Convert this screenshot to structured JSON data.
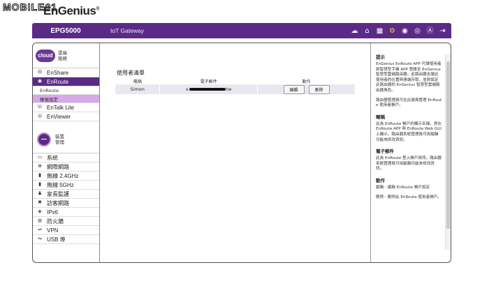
{
  "watermark": {
    "site_text": "MOBILE01",
    "logo_text": "EnGenius",
    "registered_mark": "®"
  },
  "header": {
    "model": "EPG5000",
    "section": "IoT Gateway"
  },
  "header_icons": [
    "cloud-upload-icon",
    "home-icon",
    "building-icon",
    "gear-icon",
    "wireless-icon",
    "webcam-icon",
    "language-icon",
    "logout-icon"
  ],
  "cloud": {
    "badge": "cloud",
    "title": "雲端服務"
  },
  "cloud_nav": [
    {
      "label": "EnShare",
      "icon": "share-icon"
    },
    {
      "label": "EnRoute",
      "icon": "pin-icon",
      "active": true
    }
  ],
  "enroute_sub": [
    {
      "label": "EnRoute"
    },
    {
      "label": "帳號設定",
      "active": true
    }
  ],
  "cloud_nav2": [
    {
      "label": "EnTalk Lite",
      "icon": "phone-icon"
    },
    {
      "label": "EnViewer",
      "icon": "eye-icon"
    }
  ],
  "mgmt": {
    "title": "裝置管理"
  },
  "mgmt_nav": [
    {
      "label": "系統",
      "icon": "monitor-icon"
    },
    {
      "label": "網際網路",
      "icon": "globe-icon"
    },
    {
      "label": "無線 2.4GHz",
      "icon": "signal-icon"
    },
    {
      "label": "無線 5GHz",
      "icon": "signal-icon"
    },
    {
      "label": "家長監護",
      "icon": "family-icon"
    },
    {
      "label": "訪客網路",
      "icon": "tools-icon"
    },
    {
      "label": "IPv6",
      "icon": "ipv6-icon"
    },
    {
      "label": "防火牆",
      "icon": "firewall-icon"
    },
    {
      "label": "VPN",
      "icon": "vpn-icon"
    },
    {
      "label": "USB 埠",
      "icon": "usb-icon"
    }
  ],
  "main": {
    "title": "使用者清單",
    "columns": {
      "name": "暱稱",
      "email": "電子郵件",
      "action": "動作"
    },
    "rows": [
      {
        "name": "Simon",
        "email_start": "s",
        "email_end": "tw",
        "edit": "編輯",
        "delete": "刪除"
      }
    ]
  },
  "help": {
    "title": "提示",
    "intro": "EnGenius EnRoute APP 可讓使用者將智慧型手機 APP 登錄至 EnGenius 智慧型雲端路由器。此路由器支援此使用者的位置與遠端存取，並將設定此路由器的 EnGenius 智慧型雲端路由器角色。",
    "intro2": "路由器管理員可在此頁面管理 EnRoute 使用者帳戶。",
    "nick_title": "暱稱",
    "nick_text": "此為 EnRoute 帳戶的顯示名稱，係在 EnRoute APP 與 EnRoute Web GUI 上顯示。路由器系統管理員可用編輯功能來修改資訊。",
    "email_title": "電子郵件",
    "email_text": "此為 EnRoute 登入帳戶資訊。路由器系統管理員可用編輯功能來修改資訊。",
    "action_title": "動作",
    "action_text1": "編輯 - 編輯 EnRoute 帳戶設定",
    "action_text2": "刪除 - 刪除此 EnRoute 使用者帳戶。"
  }
}
